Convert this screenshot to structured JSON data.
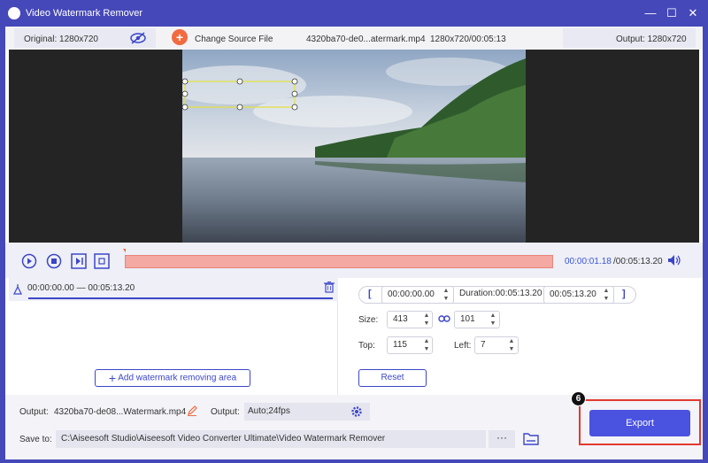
{
  "app": {
    "title": "Video Watermark Remover"
  },
  "infobar": {
    "original_label": "Original: 1280x720",
    "change_source_label": "Change Source File",
    "file_name": "4320ba70-de0...atermark.mp4",
    "file_meta": "1280x720/00:05:13",
    "output_label": "Output: 1280x720"
  },
  "playback": {
    "current_time": "00:00:01.18",
    "total_time": "/00:05:13.20"
  },
  "list": {
    "segment_range": "00:00:00.00 — 00:05:13.20",
    "add_area_label": "Add watermark removing area"
  },
  "params": {
    "start_bracket": "[",
    "end_bracket": "]",
    "start_time": "00:00:00.00",
    "duration": "Duration:00:05:13.20",
    "end_time": "00:05:13.20",
    "size_label": "Size:",
    "width": "413",
    "height": "101",
    "top_label": "Top:",
    "top": "115",
    "left_label": "Left:",
    "left": "7",
    "reset_label": "Reset"
  },
  "bottom": {
    "output_label": "Output:",
    "output_file": "4320ba70-de08...Watermark.mp4",
    "output_format_label": "Output:",
    "output_format": "Auto;24fps",
    "save_to_label": "Save to:",
    "save_path": "C:\\Aiseesoft Studio\\Aiseesoft Video Converter Ultimate\\Video Watermark Remover",
    "browse_label": "···",
    "export_label": "Export",
    "step_number": "6"
  },
  "colors": {
    "accent": "#4a52e0",
    "title_bar": "#4548b8",
    "track": "#f4a9a3",
    "highlight": "#e23a2e"
  }
}
